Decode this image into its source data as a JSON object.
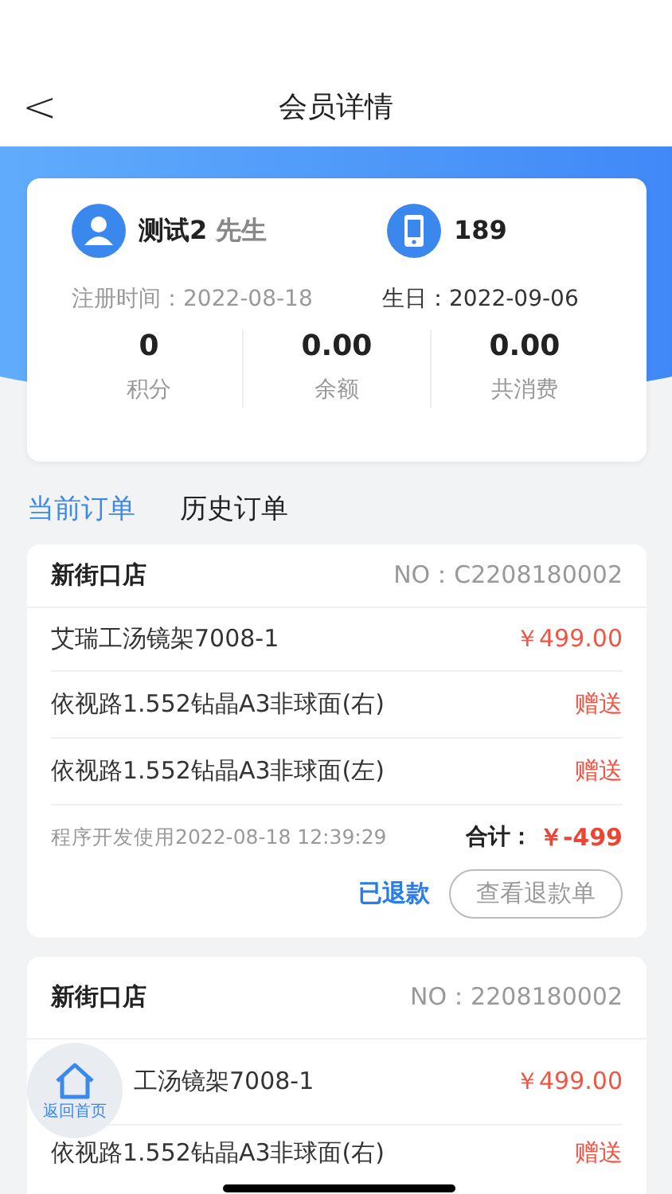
{
  "header": {
    "back": "<",
    "title": "会员详情"
  },
  "member": {
    "name": "测试2",
    "salutation": "先生",
    "phone": "189",
    "registered": "注册时间：2022-08-18",
    "birthday": "生日：2022-09-06",
    "stats": [
      {
        "value": "0",
        "label": "积分"
      },
      {
        "value": "0.00",
        "label": "余额"
      },
      {
        "value": "0.00",
        "label": "共消费"
      }
    ]
  },
  "tabs": [
    {
      "label": "当前订单",
      "selected": true
    },
    {
      "label": "历史订单",
      "selected": false
    }
  ],
  "orders": [
    {
      "store": "新街口店",
      "order_no": "NO：C2208180002",
      "items": [
        {
          "name": "艾瑞工汤镜架7008-1",
          "price": "￥499.00"
        },
        {
          "name": "依视路1.552钻晶A3非球面(右)",
          "price": "赠送"
        },
        {
          "name": "依视路1.552钻晶A3非球面(左)",
          "price": "赠送"
        }
      ],
      "note": "程序开发使用2022-08-18 12:39:29",
      "total_label": "合计：",
      "total": "￥-499",
      "status": "已退款",
      "action": "查看退款单"
    },
    {
      "store": "新街口店",
      "order_no": "NO：2208180002",
      "items": [
        {
          "name": "工汤镜架7008-1",
          "price": "￥499.00"
        },
        {
          "name": "依视路1.552钻晶A3非球面(右)",
          "price": "赠送"
        }
      ]
    }
  ],
  "home_button": {
    "label": "返回首页"
  }
}
